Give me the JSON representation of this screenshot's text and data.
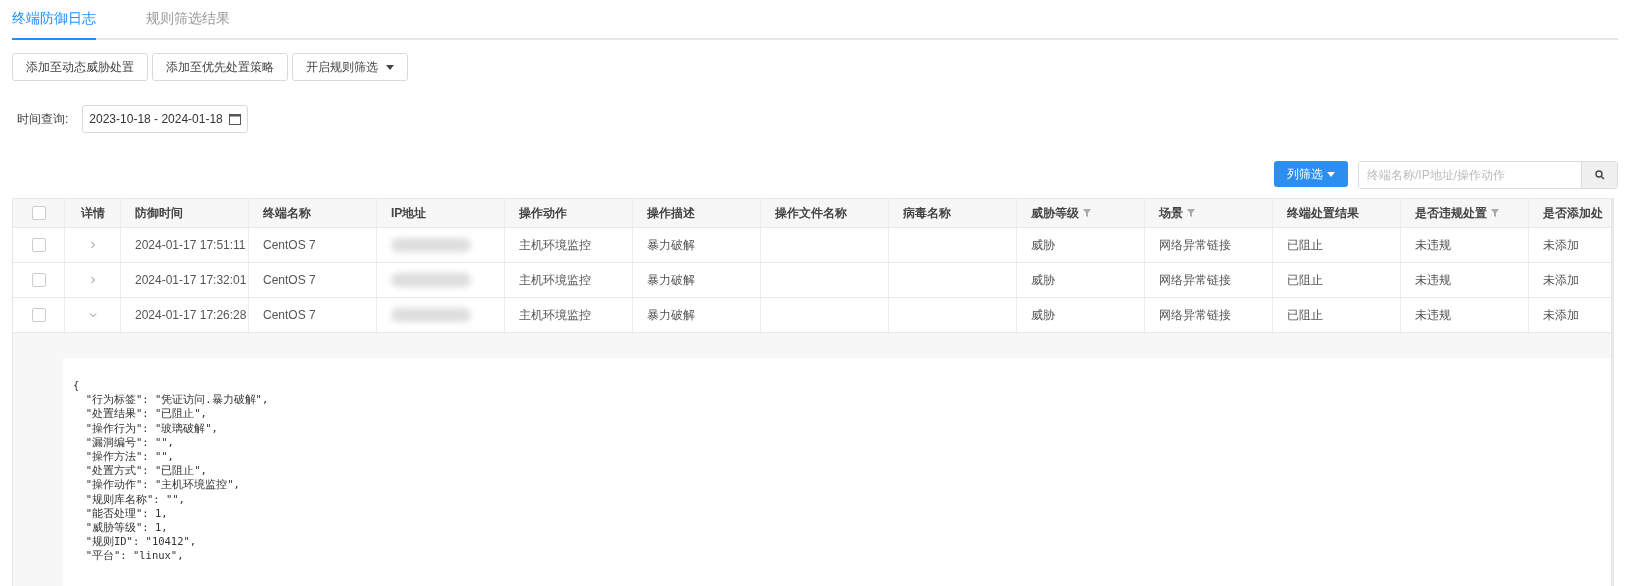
{
  "tabs": [
    {
      "label": "终端防御日志",
      "selected": true
    },
    {
      "label": "规则筛选结果",
      "selected": false
    }
  ],
  "actions": [
    {
      "label": "添加至动态威胁处置",
      "dropdown": false
    },
    {
      "label": "添加至优先处置策略",
      "dropdown": false
    },
    {
      "label": "开启规则筛选",
      "dropdown": true
    }
  ],
  "time_query": {
    "label": "时间查询:",
    "value": "2023-10-18 - 2024-01-18"
  },
  "column_filter_button": "列筛选",
  "search": {
    "placeholder": "终端名称/IP地址/操作动作"
  },
  "table": {
    "select_all_checked": false,
    "columns": [
      {
        "label": "详情",
        "filter": false
      },
      {
        "label": "防御时间",
        "filter": false
      },
      {
        "label": "终端名称",
        "filter": false
      },
      {
        "label": "IP地址",
        "filter": false
      },
      {
        "label": "操作动作",
        "filter": false
      },
      {
        "label": "操作描述",
        "filter": false
      },
      {
        "label": "操作文件名称",
        "filter": false
      },
      {
        "label": "病毒名称",
        "filter": false
      },
      {
        "label": "威胁等级",
        "filter": true
      },
      {
        "label": "场景",
        "filter": true
      },
      {
        "label": "终端处置结果",
        "filter": false
      },
      {
        "label": "是否违规处置",
        "filter": true
      },
      {
        "label": "是否添加处",
        "filter": false
      }
    ],
    "rows": [
      {
        "checked": false,
        "expanded": false,
        "time": "2024-01-17 17:51:11",
        "terminal": "CentOS 7",
        "action": "主机环境监控",
        "description": "暴力破解",
        "file": "",
        "virus": "",
        "threat": "威胁",
        "scene": "网络异常链接",
        "result": "已阻止",
        "violation": "未违规",
        "added": "未添加"
      },
      {
        "checked": false,
        "expanded": false,
        "time": "2024-01-17 17:32:01",
        "terminal": "CentOS 7",
        "action": "主机环境监控",
        "description": "暴力破解",
        "file": "",
        "virus": "",
        "threat": "威胁",
        "scene": "网络异常链接",
        "result": "已阻止",
        "violation": "未违规",
        "added": "未添加"
      },
      {
        "checked": false,
        "expanded": true,
        "time": "2024-01-17 17:26:28",
        "terminal": "CentOS 7",
        "action": "主机环境监控",
        "description": "暴力破解",
        "file": "",
        "virus": "",
        "threat": "威胁",
        "scene": "网络异常链接",
        "result": "已阻止",
        "violation": "未违规",
        "added": "未添加"
      }
    ],
    "detail_lines": [
      "{",
      "  \"行为标签\": \"凭证访问.暴力破解\",",
      "  \"处置结果\": \"已阻止\",",
      "  \"操作行为\": \"玻璃破解\",",
      "  \"漏洞编号\": \"\",",
      "  \"操作方法\": \"\",",
      "  \"处置方式\": \"已阻止\",",
      "  \"操作动作\": \"主机环境监控\",",
      "  \"规则库名称\": \"\",",
      "  \"能否处理\": 1,",
      "  \"威胁等级\": 1,",
      "  \"规则ID\": \"10412\",",
      "  \"平台\": \"linux\","
    ]
  }
}
